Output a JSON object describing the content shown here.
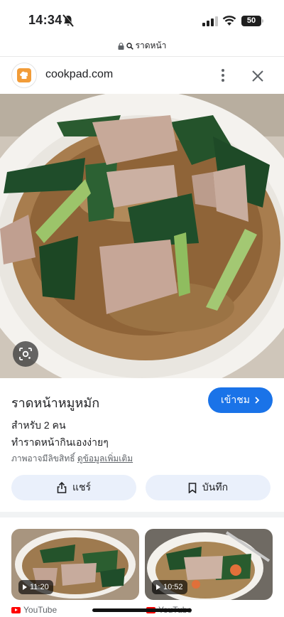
{
  "status_bar": {
    "time": "14:34",
    "battery": "50"
  },
  "url_bar": {
    "text": "ราดหน้า"
  },
  "site": {
    "name": "cookpad.com"
  },
  "recipe": {
    "title": "ราดหน้าหมูหมัก",
    "visit_label": "เข้าชม",
    "serving": "สำหรับ 2 คน",
    "description": "ทำราดหน้ากินเองง่ายๆ",
    "copyright_text": "ภาพอาจมีลิขสิทธิ์",
    "more_info_link": "ดูข้อมูลเพิ่มเติม"
  },
  "actions": {
    "share_label": "แชร์",
    "save_label": "บันทึก"
  },
  "related": [
    {
      "duration": "11:20",
      "source": "YouTube"
    },
    {
      "duration": "10:52",
      "source": "YouTube"
    }
  ],
  "colors": {
    "accent": "#1a73e8",
    "action_bg": "#eaf0fb",
    "logo": "#f29c38",
    "youtube": "#ff0000"
  }
}
